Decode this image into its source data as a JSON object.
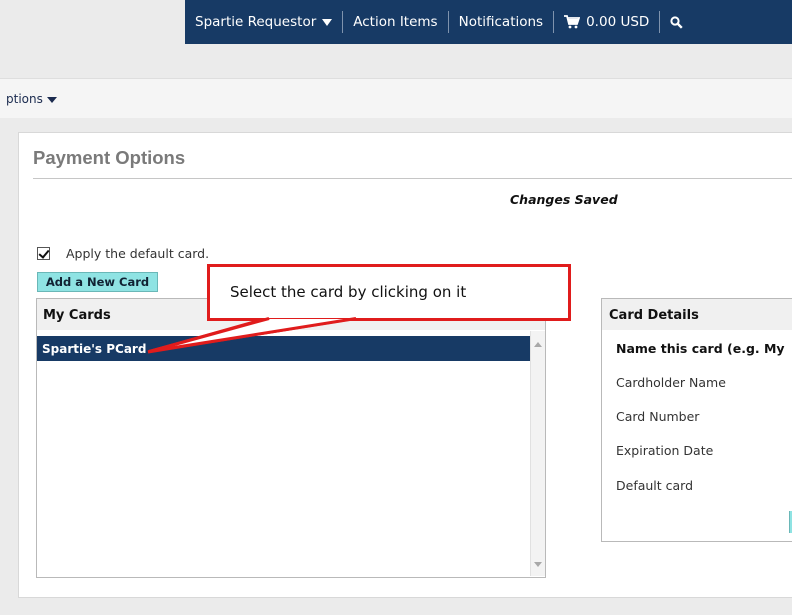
{
  "topnav": {
    "user_label": "Spartie Requestor",
    "action_items_label": "Action Items",
    "notifications_label": "Notifications",
    "cart_amount": "0.00 USD",
    "background_color": "#173a65"
  },
  "options_link": "ptions",
  "page_title": "Payment Options",
  "status_message": "Changes Saved",
  "apply_default": {
    "label": "Apply the default card.",
    "checked": true
  },
  "add_card_label": "Add a New Card",
  "my_cards": {
    "header": "My Cards",
    "items": [
      {
        "label": "Spartie's PCard",
        "selected": true
      }
    ]
  },
  "card_details": {
    "header": "Card Details",
    "fields": [
      "Name this card (e.g. My",
      "Cardholder Name",
      "Card Number",
      "Expiration Date",
      "Default card"
    ]
  },
  "annotation": {
    "text": "Select the card by clicking on it",
    "border_color": "#e01c1c"
  },
  "accent_button_color": "#8fe3e3"
}
